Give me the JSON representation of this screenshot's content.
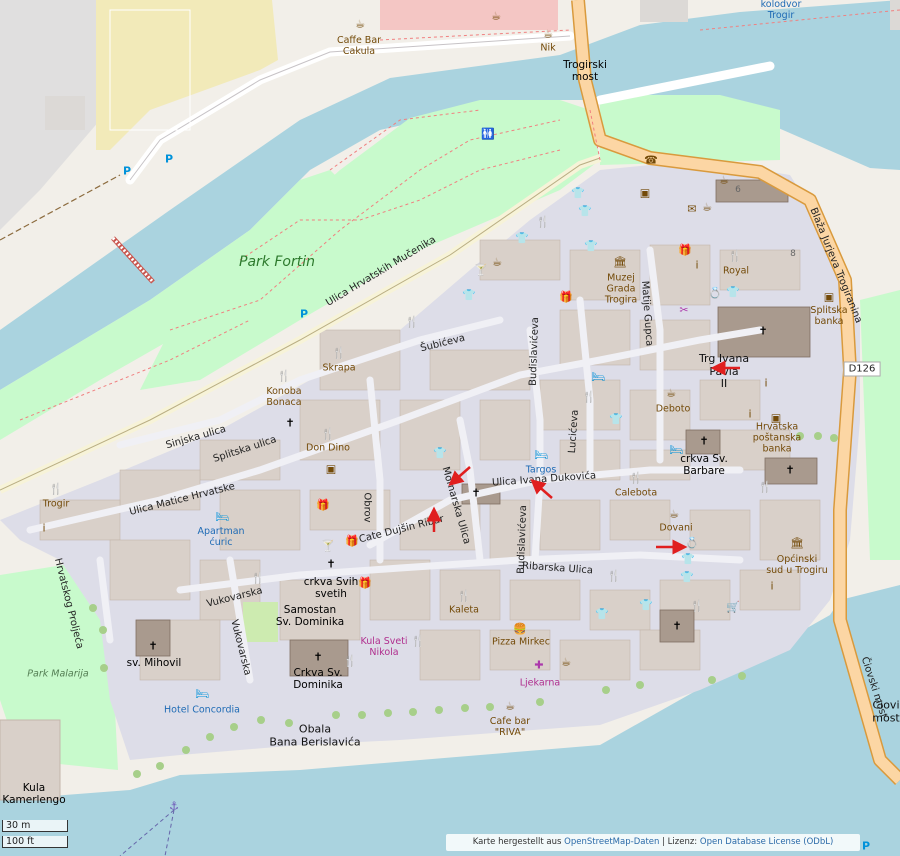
{
  "map": {
    "labels": {
      "caffe_bar_cakula": "Caffe Bar\nCakula",
      "nik": "Nik",
      "trogirski_most": "Trogirski\nmost",
      "kolodvor_trogir": "kolodvor\nTrogir",
      "park_fortin": "Park Fortin",
      "ulica_hrvatskih_mucenika": "Ulica Hrvatskih Mučenika",
      "subiceva": "Šubićeva",
      "skrapa": "Skrapa",
      "konoba_bonaca": "Konoba\nBonaca",
      "sinjska_ulica": "Sinjska ulica",
      "splitska_ulica": "Splitska ulica",
      "don_dino": "Don Dino",
      "ulica_matice_hrvatske": "Ulica Matice Hrvatske",
      "trogir": "Trogir",
      "apartman_curic": "Apartman\nćuric",
      "obrov": "Obrov",
      "cate_dujsin_ribar": "Cate Dujšin Ribar",
      "mornarska_ulica": "Mornarska Ulica",
      "budislaviceva_top": "Budislavićeva",
      "budislaviceva_bottom": "Budislavićeva",
      "luciceva": "Lucićeva",
      "matije_gupca": "Matije Gupca",
      "muzej": "Muzej\nGrada\nTrogira",
      "royal": "Royal",
      "splitska_banka": "Splitska\nbanka",
      "trg_ivana_pavla": "Trg Ivana\nPavla\nII",
      "deboto": "Deboto",
      "hrvatska_postanska_banka": "Hrvatska\npoštanska\nbanka",
      "crkva_sv_barbare": "crkva Sv.\nBarbare",
      "targos": "Targos",
      "ulica_ivana_duknovica": "Ulica Ivana Dukovića",
      "calebota": "Calebota",
      "dovani": "Dovani",
      "opcinski_sud": "Općinski\nsud u Trogiru",
      "ribarska_ulica": "Ribarska Ulica",
      "kaleta": "Kaleta",
      "pizza_mirkec": "Pizza Mirkec",
      "ljekarna": "Ljekarna",
      "cafe_bar_riva": "Cafe bar\n\"RIVA\"",
      "vukovarska_h": "Vukovarska",
      "vukovarska_v": "Vukovarska",
      "crkva_svih_svetih": "crkva Svih\nsvetih",
      "samostan": "Samostan\nSv. Dominika",
      "kula_sveti_nikola": "Kula Sveti\nNikola",
      "crkva_sv_dominika": "Crkva Sv.\nDominika",
      "sv_mihovil": "sv. Mihovil",
      "hotel_concordia": "Hotel Concordia",
      "obala": "Obala\nBana Berislavića",
      "hrvatskog_proljeca": "Hrvatskog Proljeća",
      "park_malarija": "Park Malarija",
      "kula_kamerlengo": "Kula\nKamerlengo",
      "blaza_jurjeva": "Blaža Jurjeva Trogiranina",
      "ciovski_most_v": "Čiovski most",
      "ciovski_most_h": "Čiovi\nmost",
      "d126": "D126",
      "house_6": "6",
      "house_8": "8"
    },
    "scale": {
      "metric": "30 m",
      "imperial": "100 ft"
    },
    "attribution": {
      "prefix": "Karte hergestellt aus ",
      "osm": "OpenStreetMap-Daten",
      "middle": " | Lizenz: ",
      "license": "Open Database License (ODbL)"
    },
    "colors": {
      "water": "#aad3df",
      "park": "#c8facc",
      "grass": "#cdebb0",
      "parking": "#eeeeee",
      "primary_road": "#fcd6a4",
      "primary_casing": "#d99a3d",
      "pedestrian": "#dddde8",
      "building": "#d9d0c9",
      "landuse_yellow": "#f2eab9",
      "landuse_pink": "#f4c6c4",
      "poi_brown": "#734a08",
      "poi_magenta": "#ac39ac",
      "poi_blue": "#0092da",
      "arrow_red": "#e01f1f"
    },
    "icons": [
      "cafe-icon",
      "restaurant-icon",
      "bar-icon",
      "shop-clothes-icon",
      "gift-icon",
      "church-icon",
      "bank-icon",
      "parking-icon",
      "toilets-icon",
      "museum-icon",
      "info-icon",
      "anchor-icon",
      "hotel-icon",
      "pharmacy-icon",
      "fast-food-icon",
      "jewellery-icon",
      "hairdresser-icon",
      "supermarket-icon",
      "post-icon",
      "courthouse-icon",
      "telephone-icon"
    ]
  }
}
